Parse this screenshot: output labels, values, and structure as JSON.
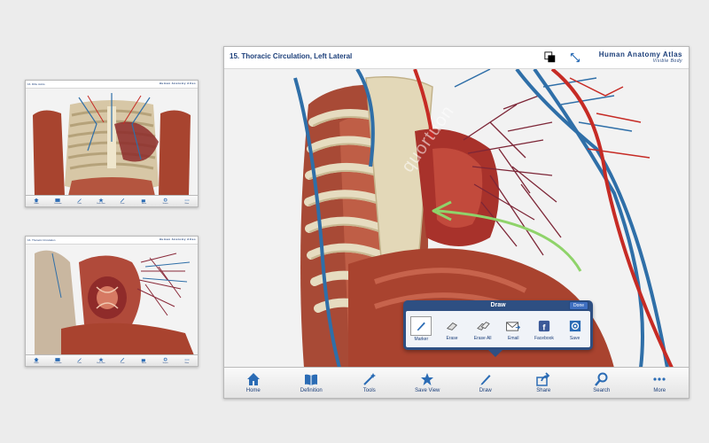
{
  "main": {
    "title": "15. Thoracic Circulation, Left Lateral",
    "brand_line1": "Human Anatomy Atlas",
    "brand_line2": "Visible Body",
    "watermark": "quortuon",
    "toolbar": [
      {
        "label": "Home",
        "icon": "home-icon"
      },
      {
        "label": "Definition",
        "icon": "book-icon"
      },
      {
        "label": "Tools",
        "icon": "wand-icon"
      },
      {
        "label": "Save View",
        "icon": "star-icon"
      },
      {
        "label": "Draw",
        "icon": "pencil-icon"
      },
      {
        "label": "Share",
        "icon": "share-icon"
      },
      {
        "label": "Search",
        "icon": "search-icon"
      },
      {
        "label": "More",
        "icon": "more-icon"
      }
    ],
    "draw_popup": {
      "title": "Draw",
      "done": "Done",
      "tools": [
        {
          "label": "Marker",
          "icon": "marker-icon"
        },
        {
          "label": "Erase",
          "icon": "eraser-icon"
        },
        {
          "label": "Erase All",
          "icon": "erase-all-icon"
        },
        {
          "label": "Email",
          "icon": "email-icon"
        },
        {
          "label": "Facebook",
          "icon": "facebook-icon"
        },
        {
          "label": "Save",
          "icon": "save-icon"
        }
      ]
    }
  },
  "top_thumb": {
    "title": "16. Ribs Joints",
    "brand": "Human Anatomy Atlas"
  },
  "bottom_thumb": {
    "title": "16. Thoracic Circulation",
    "brand": "Human Anatomy Atlas"
  },
  "thumb_toolbar": [
    "Home",
    "Definition",
    "Tools",
    "Save View",
    "Draw",
    "Share",
    "Search",
    "More"
  ],
  "bottom_watermark": "quortuon",
  "colors": {
    "brand_blue": "#1c3f7a",
    "popup_blue": "#2e4f82",
    "vein_blue": "#2f6fa8",
    "artery_red": "#c62b25",
    "muscle": "#b4553f",
    "bone": "#e3d8b8",
    "marker_green": "#8fd36a"
  }
}
